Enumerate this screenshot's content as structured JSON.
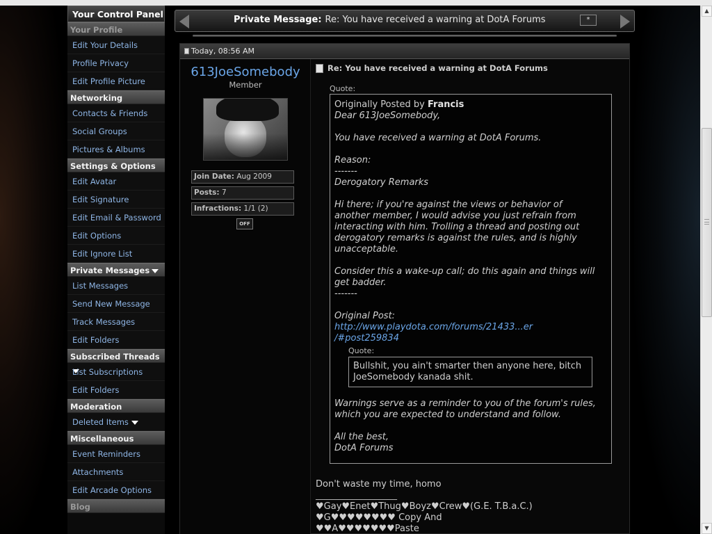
{
  "sidebar": {
    "title": "Your Control Panel",
    "sections": [
      {
        "header": "Your Profile",
        "dim": true,
        "items": [
          "Edit Your Details",
          "Profile Privacy",
          "Edit Profile Picture"
        ]
      },
      {
        "header": "Networking",
        "items": [
          "Contacts & Friends",
          "Social Groups",
          "Pictures & Albums"
        ]
      },
      {
        "header": "Settings & Options",
        "items": [
          "Edit Avatar",
          "Edit Signature",
          "Edit Email & Password",
          "Edit Options",
          "Edit Ignore List"
        ]
      },
      {
        "header": "Private Messages",
        "collapsible": true,
        "items": [
          "List Messages",
          "Send New Message",
          "Track Messages",
          "Edit Folders"
        ]
      },
      {
        "header": "Subscribed Threads",
        "collapsible": true,
        "items": [
          "List Subscriptions",
          "Edit Folders"
        ]
      },
      {
        "header": "Moderation",
        "items": [
          "Deleted Items"
        ]
      },
      {
        "header": "Miscellaneous",
        "items": [
          "Event Reminders",
          "Attachments",
          "Edit Arcade Options"
        ]
      },
      {
        "header": "Blog",
        "dim": true,
        "items": []
      }
    ]
  },
  "header": {
    "label": "Private Message:",
    "subject": "Re: You have received a warning at DotA Forums",
    "collapse_symbol": "*"
  },
  "post": {
    "date": "Today, 08:56 AM",
    "user": {
      "name": "613JoeSomebody",
      "title": "Member",
      "join_label": "Join Date:",
      "join_value": "Aug 2009",
      "posts_label": "Posts:",
      "posts_value": "7",
      "infractions_label": "Infractions:",
      "infractions_value": "1/1 (2)",
      "status_icon_text": "OFF"
    },
    "title": "Re: You have received a warning at DotA Forums",
    "quote_label": "Quote:",
    "quote": {
      "originally": "Originally Posted by",
      "author": "Francis",
      "greeting": "Dear 613JoeSomebody,",
      "warned": "You have received a warning at DotA Forums.",
      "reason_label": "Reason:",
      "dashes": "-------",
      "reason": "Derogatory Remarks",
      "para1_l1": "Hi there; if you're against the views or behavior of",
      "para1_l2": "another member, I would advise you just refrain from",
      "para1_l3": "interacting with him. Trolling a thread and posting out",
      "para1_l4": "derogatory remarks is against the rules, and is highly",
      "para1_l5": "unacceptable.",
      "para2_l1": "Consider this a wake-up call; do this again and things will",
      "para2_l2": "get badder.",
      "dashes2": "-------",
      "orig_post_label": "Original Post:",
      "link_l1": "http://www.playdota.com/forums/21433...er",
      "link_l2": "/#post259834",
      "inner_quote_label": "Quote:",
      "inner_l1": "Bullshit, you ain't smarter then anyone here, bitch",
      "inner_l2": "JoeSomebody kanada shit.",
      "closing_l1": "Warnings serve as a reminder to you of the forum's rules,",
      "closing_l2": "which you are expected to understand and follow.",
      "signoff_l1": "All the best,",
      "signoff_l2": "DotA Forums"
    },
    "message": "Don't waste my time, homo",
    "signature": {
      "separator": "__________________",
      "line1": "♥Gay♥Enet♥Thug♥Boyz♥Crew♥(G.E. T.B.a.C.)",
      "line2": "♥G♥♥♥♥♥♥♥♥ Copy And",
      "line3": "♥♥A♥♥♥♥♥♥♥Paste"
    }
  }
}
